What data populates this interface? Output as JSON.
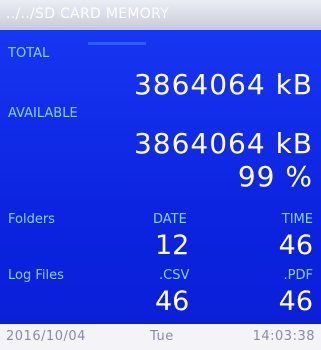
{
  "title": "../../SD CARD MEMORY",
  "total": {
    "label": "TOTAL",
    "value": "3864064 kB"
  },
  "available": {
    "label": "AVAILABLE",
    "value": "3864064 kB",
    "percent": "99 %"
  },
  "folders": {
    "label": "Folders",
    "date_header": "DATE",
    "time_header": "TIME",
    "date_count": "12",
    "time_count": "46"
  },
  "log_files": {
    "label": "Log Files",
    "csv_header": ".CSV",
    "pdf_header": ".PDF",
    "csv_count": "46",
    "pdf_count": "46"
  },
  "status": {
    "date": "2016/10/04",
    "day": "Tue",
    "time": "14:03:38"
  },
  "colors": {
    "panel": "#0c24e0",
    "label": "#8fd0ff",
    "value": "#ffffff"
  }
}
